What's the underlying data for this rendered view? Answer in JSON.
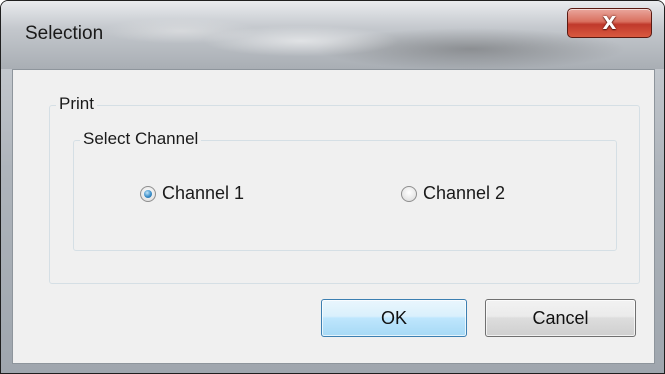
{
  "window": {
    "title": "Selection",
    "close_glyph": "X"
  },
  "print_group": {
    "label": "Print",
    "channel_group": {
      "label": "Select Channel",
      "options": [
        {
          "label": "Channel 1",
          "checked": true
        },
        {
          "label": "Channel 2",
          "checked": false
        }
      ]
    }
  },
  "buttons": {
    "ok_label": "OK",
    "cancel_label": "Cancel"
  },
  "colors": {
    "close_button": "#c0392b",
    "default_button_border": "#3c7fb1",
    "radio_selected": "#3a8ec9"
  },
  "icons": {
    "close": "close-icon"
  }
}
